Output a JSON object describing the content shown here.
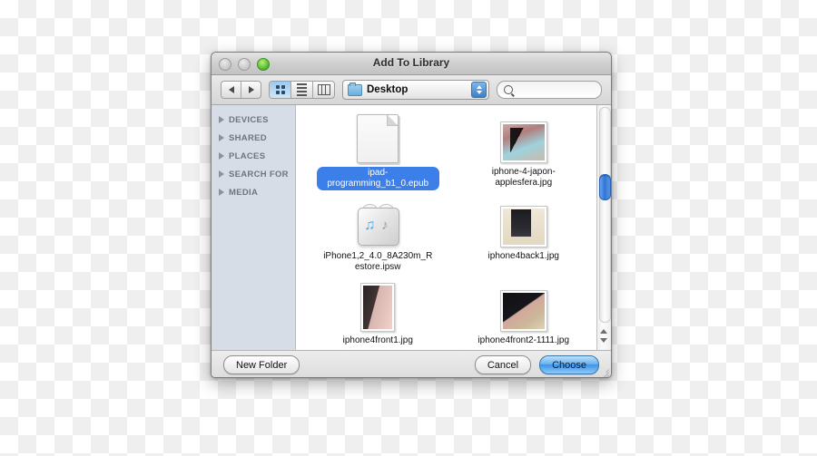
{
  "window": {
    "title": "Add To Library",
    "traffic_lights": [
      "close-disabled",
      "minimize-disabled",
      "zoom-enabled"
    ]
  },
  "toolbar": {
    "back_icon": "back-arrow-icon",
    "forward_icon": "forward-arrow-icon",
    "view_modes": [
      {
        "name": "icon-view",
        "selected": true
      },
      {
        "name": "list-view",
        "selected": false
      },
      {
        "name": "column-view",
        "selected": false
      }
    ],
    "path_popup": {
      "value": "Desktop",
      "icon": "folder-icon"
    },
    "search": {
      "value": "",
      "placeholder": "",
      "icon": "search-icon"
    }
  },
  "sidebar": {
    "sections": [
      {
        "label": "DEVICES",
        "expanded": false
      },
      {
        "label": "SHARED",
        "expanded": false
      },
      {
        "label": "PLACES",
        "expanded": false
      },
      {
        "label": "SEARCH FOR",
        "expanded": false
      },
      {
        "label": "MEDIA",
        "expanded": false
      }
    ]
  },
  "files": [
    {
      "name": "ipad-programming_b1_0.epub",
      "icon": "document-icon",
      "selected": true
    },
    {
      "name": "iphone-4-japon-applesfera.jpg",
      "icon": "photo-thumbnail",
      "selected": false
    },
    {
      "name": "iPhone1,2_4.0_8A230m_Restore.ipsw",
      "icon": "ipsw-firmware-icon",
      "selected": false
    },
    {
      "name": "iphone4back1.jpg",
      "icon": "photo-thumbnail",
      "selected": false
    },
    {
      "name": "iphone4front1.jpg",
      "icon": "photo-thumbnail",
      "selected": false
    },
    {
      "name": "iphone4front2-1111.jpg",
      "icon": "photo-thumbnail",
      "selected": false
    }
  ],
  "footer": {
    "new_folder_label": "New Folder",
    "cancel_label": "Cancel",
    "choose_label": "Choose"
  },
  "colors": {
    "selection_blue": "#3d7fe8",
    "default_button_blue": "#3d94ea",
    "sidebar_bg": "#d7dde6",
    "zoom_green": "#4fb52a"
  }
}
